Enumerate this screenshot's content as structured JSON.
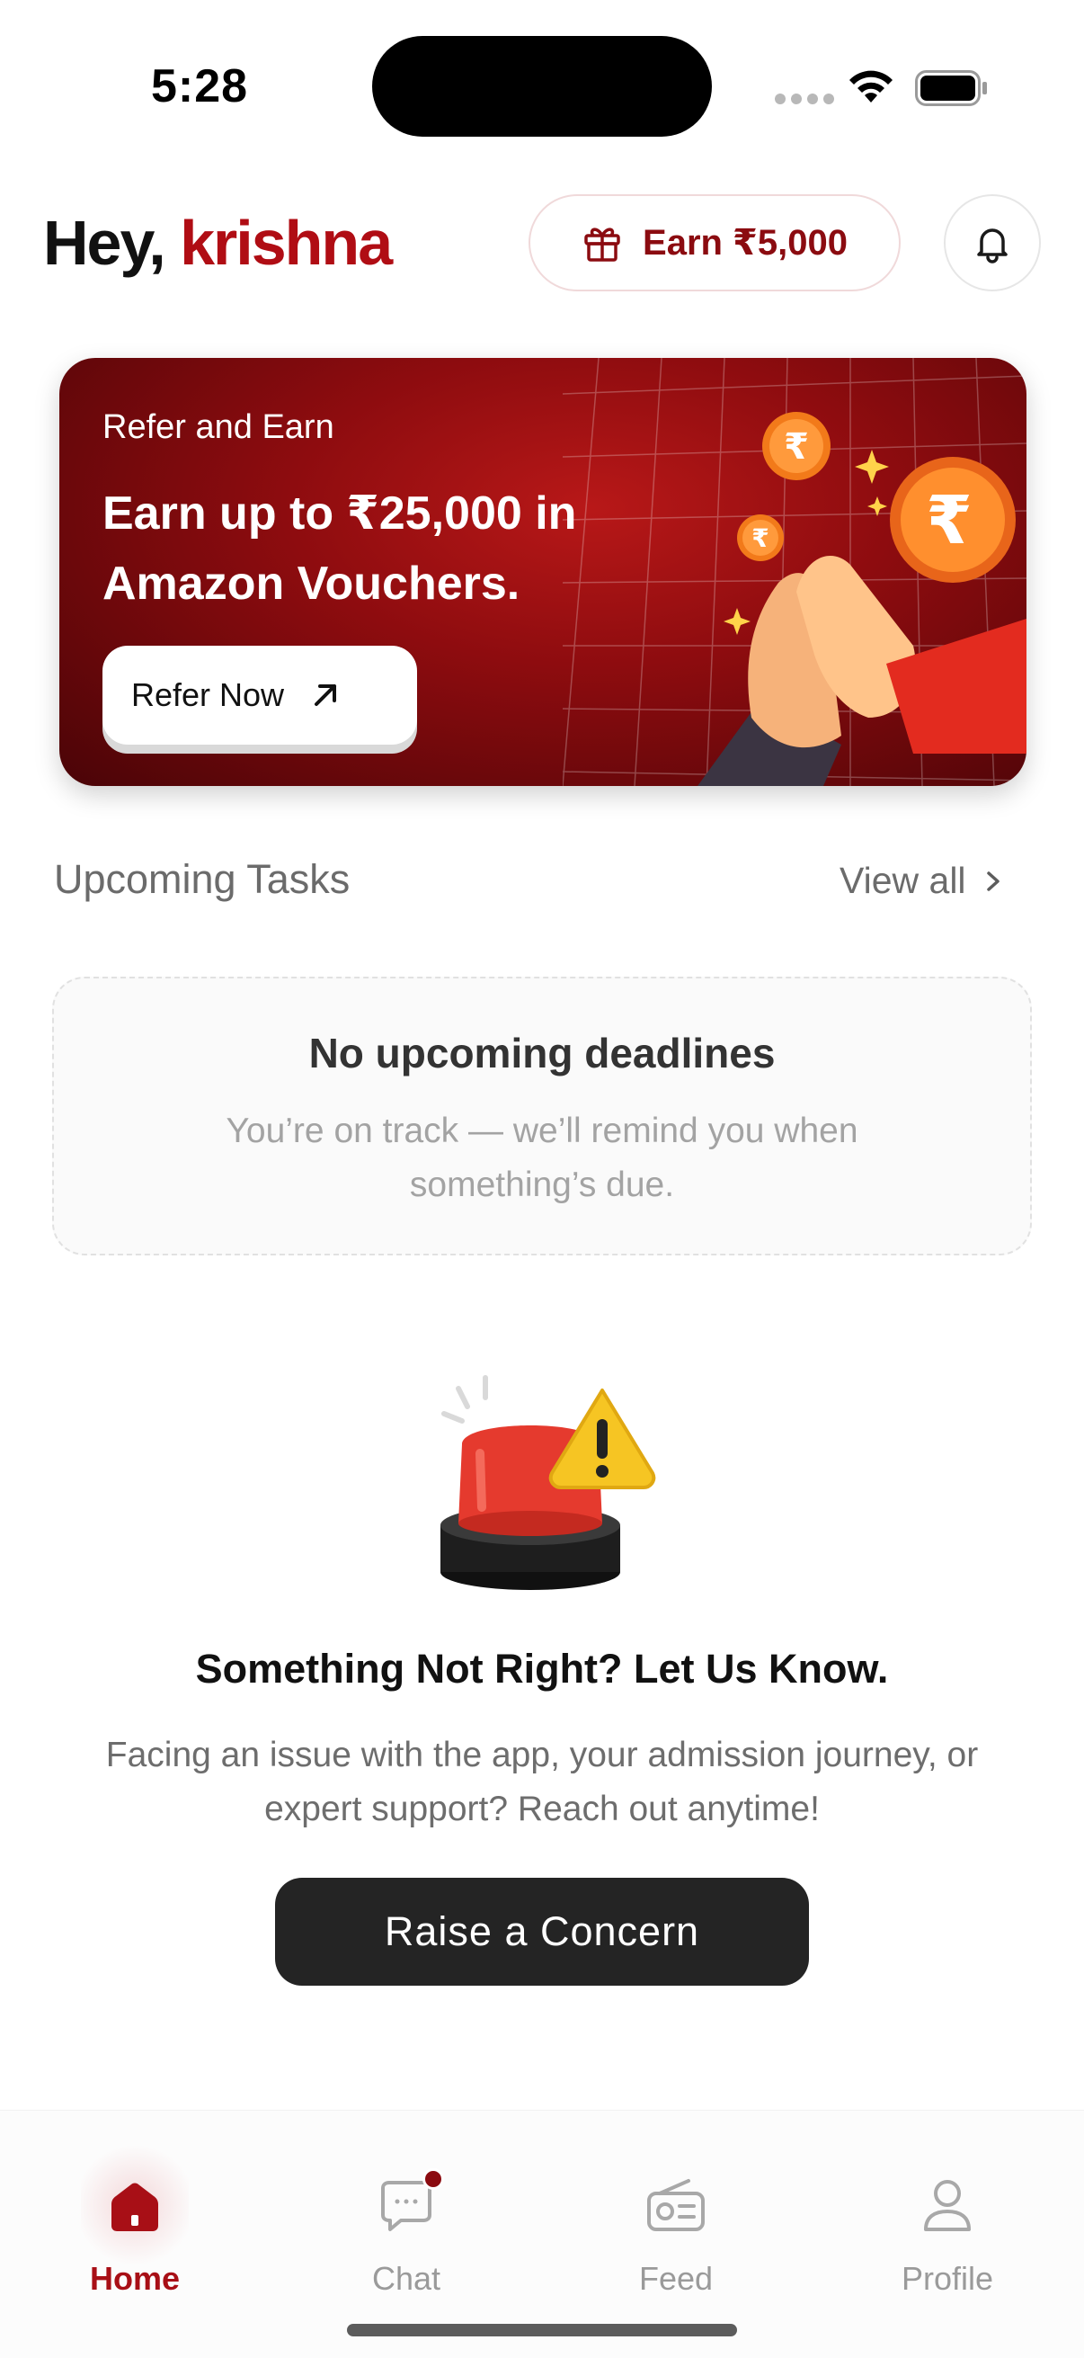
{
  "status_bar": {
    "time": "5:28"
  },
  "header": {
    "greeting_prefix": "Hey,",
    "user_name": "krishna",
    "earn_label": "Earn ₹5,000"
  },
  "banner": {
    "kicker": "Refer and Earn",
    "title": "Earn up to ₹25,000 in Amazon Vouchers.",
    "cta_label": "Refer Now"
  },
  "upcoming_tasks": {
    "title": "Upcoming Tasks",
    "view_all_label": "View all",
    "empty_title": "No upcoming deadlines",
    "empty_subtitle": "You’re on track — we’ll remind you when something’s due."
  },
  "concern": {
    "title": "Something Not Right? Let Us Know.",
    "subtitle": "Facing an issue with the app, your admission journey, or expert support? Reach out anytime!",
    "button_label": "Raise a Concern"
  },
  "tab_bar": {
    "tabs": [
      {
        "label": "Home",
        "icon": "home-icon",
        "active": true
      },
      {
        "label": "Chat",
        "icon": "chat-icon",
        "active": false,
        "has_notification_dot": true
      },
      {
        "label": "Feed",
        "icon": "radio-feed-icon",
        "active": false
      },
      {
        "label": "Profile",
        "icon": "profile-icon",
        "active": false
      }
    ]
  },
  "colors": {
    "brand": "#b00d14",
    "brand_dark": "#8b0b10",
    "button_dark": "#242424",
    "muted_text": "#6b6b6b"
  }
}
